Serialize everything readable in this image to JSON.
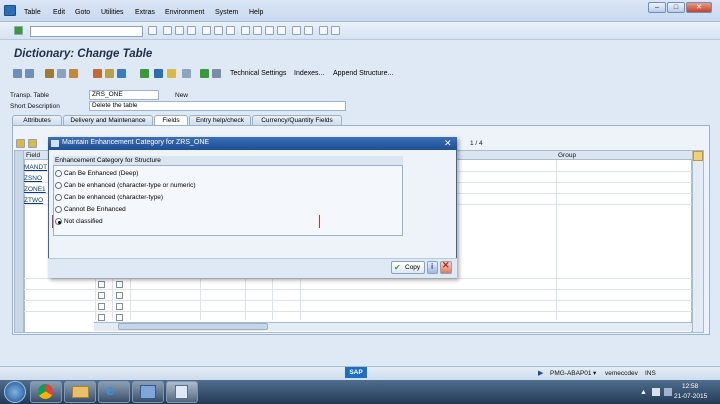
{
  "menu": {
    "items": [
      "Table",
      "Edit",
      "Goto",
      "Utilities",
      "Extras",
      "Environment",
      "System",
      "Help"
    ]
  },
  "window_controls": {
    "minimize": "–",
    "maximize": "□",
    "close": "✕"
  },
  "screen": {
    "title": "Dictionary: Change Table",
    "app_toolbar": [
      "Technical Settings",
      "Indexes...",
      "Append Structure..."
    ]
  },
  "header": {
    "table_label": "Transp. Table",
    "table_value": "ZRS_ONE",
    "status": "New",
    "desc_label": "Short Description",
    "desc_value": "Delete the table"
  },
  "tabs": [
    "Attributes",
    "Delivery and Maintenance",
    "Fields",
    "Entry help/check",
    "Currency/Quantity Fields"
  ],
  "grid": {
    "page": "1 / 4",
    "col_field": "Field",
    "col_group": "Group",
    "rows": [
      "MANDT",
      "ZSNO",
      "ZONE1",
      "ZTWO"
    ]
  },
  "dialog": {
    "title": "Maintain Enhancement Category for ZRS_ONE",
    "group_title": "Enhancement Category for Structure",
    "options": [
      "Can Be Enhanced (Deep)",
      "Can be enhanced (character-type or numeric)",
      "Can be enhanced (character-type)",
      "Cannot Be Enhanced",
      "Not classified"
    ],
    "selected_index": 4,
    "copy_label": "Copy",
    "close_label": "×"
  },
  "status": {
    "system": "PMG-ABAP01",
    "user": "vemeccdev",
    "mode": "INS"
  },
  "taskbar": {
    "time": "12:58",
    "date": "21-07-2015"
  },
  "colors": {
    "title_bar": "#1f4e94",
    "background": "#dfe9f5",
    "taskbar": "#233a55"
  }
}
